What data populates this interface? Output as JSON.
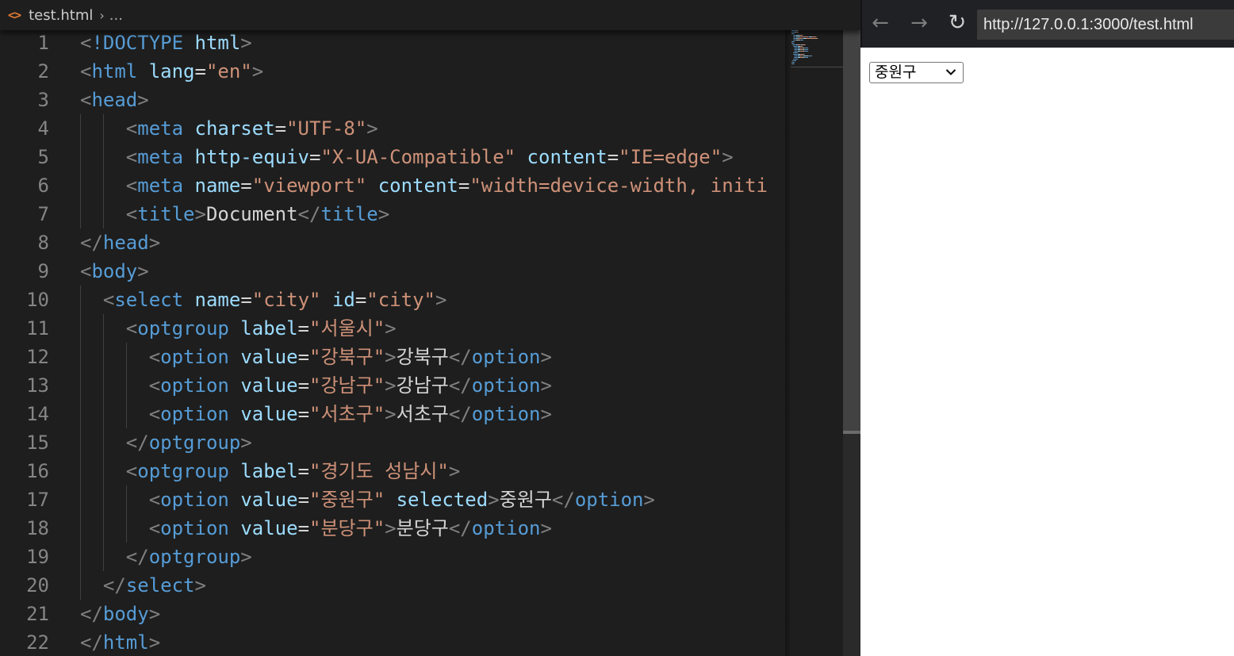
{
  "editor": {
    "breadcrumb": {
      "icon": "html-file-icon",
      "file": "test.html",
      "separator": "›",
      "more": "..."
    },
    "lines": [
      {
        "n": "1",
        "tokens": [
          [
            "p",
            "<"
          ],
          [
            "t",
            "!DOCTYPE"
          ],
          [
            "e",
            " "
          ],
          [
            "a",
            "html"
          ],
          [
            "p",
            ">"
          ]
        ]
      },
      {
        "n": "2",
        "tokens": [
          [
            "p",
            "<"
          ],
          [
            "t",
            "html"
          ],
          [
            "e",
            " "
          ],
          [
            "a",
            "lang"
          ],
          [
            "e",
            "="
          ],
          [
            "s",
            "\"en\""
          ],
          [
            "p",
            ">"
          ]
        ]
      },
      {
        "n": "3",
        "tokens": [
          [
            "p",
            "<"
          ],
          [
            "t",
            "head"
          ],
          [
            "p",
            ">"
          ]
        ]
      },
      {
        "n": "4",
        "tokens": [
          [
            "e",
            "    "
          ],
          [
            "p",
            "<"
          ],
          [
            "t",
            "meta"
          ],
          [
            "e",
            " "
          ],
          [
            "a",
            "charset"
          ],
          [
            "e",
            "="
          ],
          [
            "s",
            "\"UTF-8\""
          ],
          [
            "p",
            ">"
          ]
        ]
      },
      {
        "n": "5",
        "tokens": [
          [
            "e",
            "    "
          ],
          [
            "p",
            "<"
          ],
          [
            "t",
            "meta"
          ],
          [
            "e",
            " "
          ],
          [
            "a",
            "http-equiv"
          ],
          [
            "e",
            "="
          ],
          [
            "s",
            "\"X-UA-Compatible\""
          ],
          [
            "e",
            " "
          ],
          [
            "a",
            "content"
          ],
          [
            "e",
            "="
          ],
          [
            "s",
            "\"IE=edge\""
          ],
          [
            "p",
            ">"
          ]
        ]
      },
      {
        "n": "6",
        "tokens": [
          [
            "e",
            "    "
          ],
          [
            "p",
            "<"
          ],
          [
            "t",
            "meta"
          ],
          [
            "e",
            " "
          ],
          [
            "a",
            "name"
          ],
          [
            "e",
            "="
          ],
          [
            "s",
            "\"viewport\""
          ],
          [
            "e",
            " "
          ],
          [
            "a",
            "content"
          ],
          [
            "e",
            "="
          ],
          [
            "s",
            "\"width=device-width, initi"
          ]
        ]
      },
      {
        "n": "7",
        "tokens": [
          [
            "e",
            "    "
          ],
          [
            "p",
            "<"
          ],
          [
            "t",
            "title"
          ],
          [
            "p",
            ">"
          ],
          [
            "x",
            "Document"
          ],
          [
            "p",
            "</"
          ],
          [
            "t",
            "title"
          ],
          [
            "p",
            ">"
          ]
        ]
      },
      {
        "n": "8",
        "tokens": [
          [
            "p",
            "</"
          ],
          [
            "t",
            "head"
          ],
          [
            "p",
            ">"
          ]
        ]
      },
      {
        "n": "9",
        "tokens": [
          [
            "p",
            "<"
          ],
          [
            "t",
            "body"
          ],
          [
            "p",
            ">"
          ]
        ]
      },
      {
        "n": "10",
        "tokens": [
          [
            "e",
            "  "
          ],
          [
            "p",
            "<"
          ],
          [
            "t",
            "select"
          ],
          [
            "e",
            " "
          ],
          [
            "a",
            "name"
          ],
          [
            "e",
            "="
          ],
          [
            "s",
            "\"city\""
          ],
          [
            "e",
            " "
          ],
          [
            "a",
            "id"
          ],
          [
            "e",
            "="
          ],
          [
            "s",
            "\"city\""
          ],
          [
            "p",
            ">"
          ]
        ]
      },
      {
        "n": "11",
        "tokens": [
          [
            "e",
            "    "
          ],
          [
            "p",
            "<"
          ],
          [
            "t",
            "optgroup"
          ],
          [
            "e",
            " "
          ],
          [
            "a",
            "label"
          ],
          [
            "e",
            "="
          ],
          [
            "s",
            "\"서울시\""
          ],
          [
            "p",
            ">"
          ]
        ]
      },
      {
        "n": "12",
        "tokens": [
          [
            "e",
            "      "
          ],
          [
            "p",
            "<"
          ],
          [
            "t",
            "option"
          ],
          [
            "e",
            " "
          ],
          [
            "a",
            "value"
          ],
          [
            "e",
            "="
          ],
          [
            "s",
            "\"강북구\""
          ],
          [
            "p",
            ">"
          ],
          [
            "x",
            "강북구"
          ],
          [
            "p",
            "</"
          ],
          [
            "t",
            "option"
          ],
          [
            "p",
            ">"
          ]
        ]
      },
      {
        "n": "13",
        "tokens": [
          [
            "e",
            "      "
          ],
          [
            "p",
            "<"
          ],
          [
            "t",
            "option"
          ],
          [
            "e",
            " "
          ],
          [
            "a",
            "value"
          ],
          [
            "e",
            "="
          ],
          [
            "s",
            "\"강남구\""
          ],
          [
            "p",
            ">"
          ],
          [
            "x",
            "강남구"
          ],
          [
            "p",
            "</"
          ],
          [
            "t",
            "option"
          ],
          [
            "p",
            ">"
          ]
        ]
      },
      {
        "n": "14",
        "tokens": [
          [
            "e",
            "      "
          ],
          [
            "p",
            "<"
          ],
          [
            "t",
            "option"
          ],
          [
            "e",
            " "
          ],
          [
            "a",
            "value"
          ],
          [
            "e",
            "="
          ],
          [
            "s",
            "\"서초구\""
          ],
          [
            "p",
            ">"
          ],
          [
            "x",
            "서초구"
          ],
          [
            "p",
            "</"
          ],
          [
            "t",
            "option"
          ],
          [
            "p",
            ">"
          ]
        ]
      },
      {
        "n": "15",
        "tokens": [
          [
            "e",
            "    "
          ],
          [
            "p",
            "</"
          ],
          [
            "t",
            "optgroup"
          ],
          [
            "p",
            ">"
          ]
        ]
      },
      {
        "n": "16",
        "tokens": [
          [
            "e",
            "    "
          ],
          [
            "p",
            "<"
          ],
          [
            "t",
            "optgroup"
          ],
          [
            "e",
            " "
          ],
          [
            "a",
            "label"
          ],
          [
            "e",
            "="
          ],
          [
            "s",
            "\"경기도 성남시\""
          ],
          [
            "p",
            ">"
          ]
        ]
      },
      {
        "n": "17",
        "tokens": [
          [
            "e",
            "      "
          ],
          [
            "p",
            "<"
          ],
          [
            "t",
            "option"
          ],
          [
            "e",
            " "
          ],
          [
            "a",
            "value"
          ],
          [
            "e",
            "="
          ],
          [
            "s",
            "\"중원구\""
          ],
          [
            "e",
            " "
          ],
          [
            "a",
            "selected"
          ],
          [
            "p",
            ">"
          ],
          [
            "x",
            "중원구"
          ],
          [
            "p",
            "</"
          ],
          [
            "t",
            "option"
          ],
          [
            "p",
            ">"
          ]
        ]
      },
      {
        "n": "18",
        "tokens": [
          [
            "e",
            "      "
          ],
          [
            "p",
            "<"
          ],
          [
            "t",
            "option"
          ],
          [
            "e",
            " "
          ],
          [
            "a",
            "value"
          ],
          [
            "e",
            "="
          ],
          [
            "s",
            "\"분당구\""
          ],
          [
            "p",
            ">"
          ],
          [
            "x",
            "분당구"
          ],
          [
            "p",
            "</"
          ],
          [
            "t",
            "option"
          ],
          [
            "p",
            ">"
          ]
        ]
      },
      {
        "n": "19",
        "tokens": [
          [
            "e",
            "    "
          ],
          [
            "p",
            "</"
          ],
          [
            "t",
            "optgroup"
          ],
          [
            "p",
            ">"
          ]
        ]
      },
      {
        "n": "20",
        "tokens": [
          [
            "e",
            "  "
          ],
          [
            "p",
            "</"
          ],
          [
            "t",
            "select"
          ],
          [
            "p",
            ">"
          ]
        ]
      },
      {
        "n": "21",
        "tokens": [
          [
            "p",
            "</"
          ],
          [
            "t",
            "body"
          ],
          [
            "p",
            ">"
          ]
        ]
      },
      {
        "n": "22",
        "tokens": [
          [
            "p",
            "</"
          ],
          [
            "t",
            "html"
          ],
          [
            "p",
            ">"
          ]
        ]
      }
    ]
  },
  "browser": {
    "back_icon": "arrow-left-icon",
    "forward_icon": "arrow-right-icon",
    "reload_icon": "reload-icon",
    "url": "http://127.0.0.1:3000/test.html",
    "select": {
      "selected": "중원구",
      "icon": "chevron-down-icon"
    }
  }
}
